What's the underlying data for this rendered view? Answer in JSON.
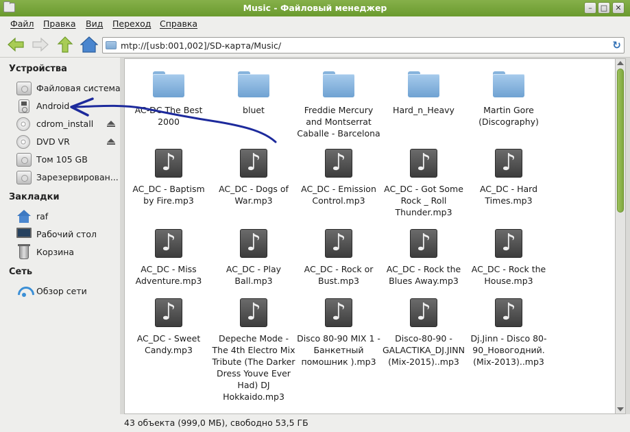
{
  "window": {
    "title": "Music - Файловый менеджер"
  },
  "menu": [
    "Файл",
    "Правка",
    "Вид",
    "Переход",
    "Справка"
  ],
  "address": {
    "path": "mtp://[usb:001,002]/SD-карта/Music/"
  },
  "sidebar": {
    "sections": [
      {
        "title": "Устройства",
        "items": [
          {
            "label": "Файловая система",
            "icon": "hard-disk-icon"
          },
          {
            "label": "Android",
            "icon": "media-player-icon"
          },
          {
            "label": "cdrom_install",
            "icon": "optical-disc-icon",
            "eject": true
          },
          {
            "label": "DVD VR",
            "icon": "optical-disc-icon",
            "eject": true
          },
          {
            "label": "Том 105 GB",
            "icon": "hard-disk-icon"
          },
          {
            "label": "Зарезервирован...",
            "icon": "hard-disk-icon"
          }
        ]
      },
      {
        "title": "Закладки",
        "items": [
          {
            "label": "raf",
            "icon": "home-folder-icon"
          },
          {
            "label": "Рабочий стол",
            "icon": "desktop-icon"
          },
          {
            "label": "Корзина",
            "icon": "trash-icon"
          }
        ]
      },
      {
        "title": "Сеть",
        "items": [
          {
            "label": "Обзор сети",
            "icon": "network-icon"
          }
        ]
      }
    ]
  },
  "files": [
    {
      "name": "AC-DC The Best 2000",
      "type": "folder"
    },
    {
      "name": "bluet",
      "type": "folder"
    },
    {
      "name": "Freddie Mercury and Montserrat Caballe - Barcelona",
      "type": "folder"
    },
    {
      "name": "Hard_n_Heavy",
      "type": "folder"
    },
    {
      "name": "Martin Gore (Discography)",
      "type": "folder"
    },
    {
      "name": "AC_DC - Baptism by Fire.mp3",
      "type": "audio"
    },
    {
      "name": "AC_DC - Dogs of War.mp3",
      "type": "audio"
    },
    {
      "name": "AC_DC - Emission Control.mp3",
      "type": "audio"
    },
    {
      "name": "AC_DC - Got Some Rock _ Roll Thunder.mp3",
      "type": "audio"
    },
    {
      "name": "AC_DC - Hard Times.mp3",
      "type": "audio"
    },
    {
      "name": "AC_DC - Miss Adventure.mp3",
      "type": "audio"
    },
    {
      "name": "AC_DC - Play Ball.mp3",
      "type": "audio"
    },
    {
      "name": "AC_DC - Rock or Bust.mp3",
      "type": "audio"
    },
    {
      "name": "AC_DC - Rock the Blues Away.mp3",
      "type": "audio"
    },
    {
      "name": "AC_DC - Rock the House.mp3",
      "type": "audio"
    },
    {
      "name": "AC_DC - Sweet Candy.mp3",
      "type": "audio"
    },
    {
      "name": "Depeche Mode - The 4th Electro Mix Tribute (The Darker Dress Youve Ever Had) DJ Hokkaido.mp3",
      "type": "audio"
    },
    {
      "name": "Disco 80-90 MIX 1 - Банкетный помошник ).mp3",
      "type": "audio"
    },
    {
      "name": "Disco-80-90 - GALACTIKA_DJ.JINN (Mix-2015)..mp3",
      "type": "audio"
    },
    {
      "name": "Dj.Jinn - Disco 80-90_Новогодний.(Mix-2013)..mp3",
      "type": "audio"
    }
  ],
  "status": {
    "text": "43 объекта (999,0 МБ), свободно 53,5 ГБ"
  },
  "colors": {
    "accent": "#7fa93e",
    "annotation": "#1d2a9c"
  }
}
